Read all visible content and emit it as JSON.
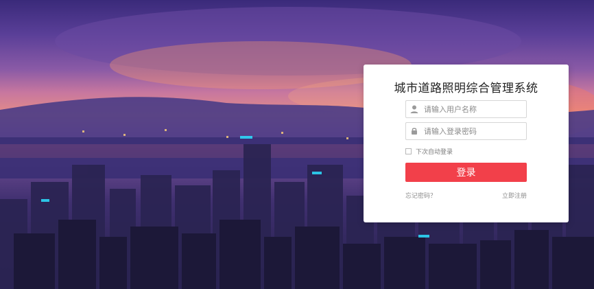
{
  "login": {
    "title": "城市道路照明综合管理系统",
    "username_placeholder": "请输入用户名称",
    "password_placeholder": "请输入登录密码",
    "remember_label": "下次自动登录",
    "login_button": "登录",
    "forgot_password": "忘记密码？",
    "register": "立即注册"
  },
  "icons": {
    "user": "user-icon",
    "lock": "lock-icon"
  },
  "colors": {
    "accent": "#f2404a",
    "card_bg": "#ffffff"
  }
}
